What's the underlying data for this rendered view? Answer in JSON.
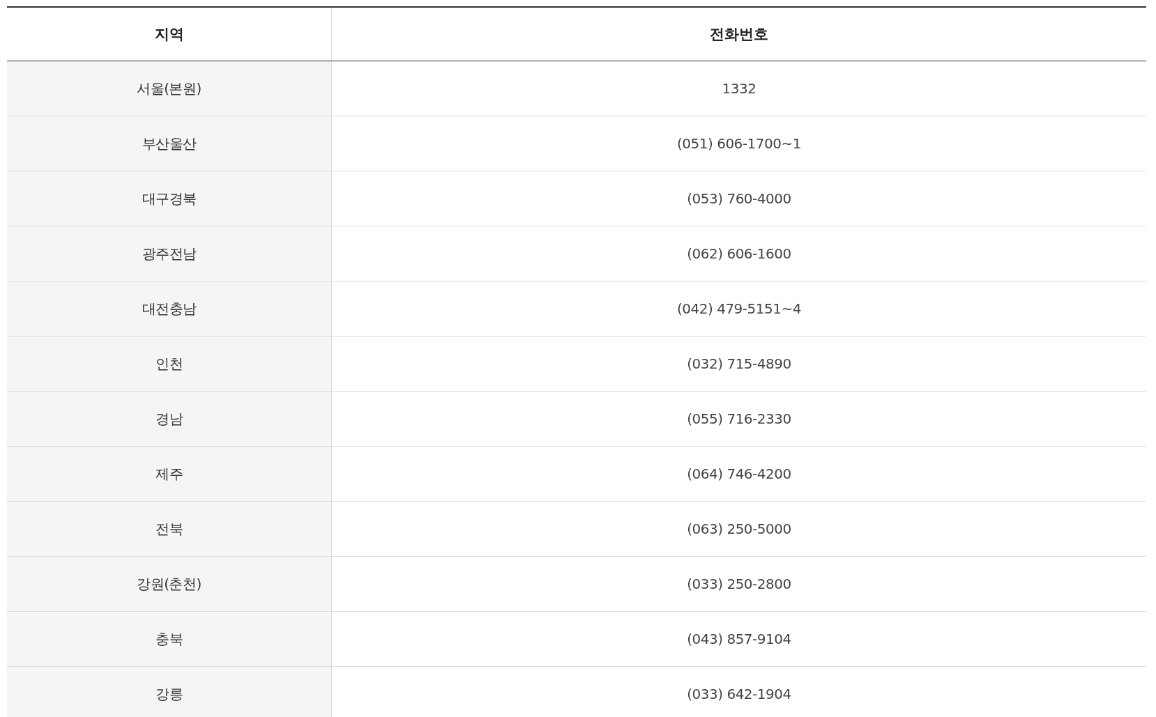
{
  "table": {
    "columns": [
      "지역",
      "전화번호"
    ],
    "rows": [
      {
        "region": "서울(본원)",
        "phone": "1332"
      },
      {
        "region": "부산울산",
        "phone": "(051) 606-1700~1"
      },
      {
        "region": "대구경북",
        "phone": "(053) 760-4000"
      },
      {
        "region": "광주전남",
        "phone": "(062) 606-1600"
      },
      {
        "region": "대전충남",
        "phone": "(042) 479-5151~4"
      },
      {
        "region": "인천",
        "phone": "(032) 715-4890"
      },
      {
        "region": "경남",
        "phone": "(055) 716-2330"
      },
      {
        "region": "제주",
        "phone": "(064) 746-4200"
      },
      {
        "region": "전북",
        "phone": "(063) 250-5000"
      },
      {
        "region": "강원(춘천)",
        "phone": "(033) 250-2800"
      },
      {
        "region": "충북",
        "phone": "(043) 857-9104"
      },
      {
        "region": "강릉",
        "phone": "(033) 642-1904"
      }
    ]
  }
}
